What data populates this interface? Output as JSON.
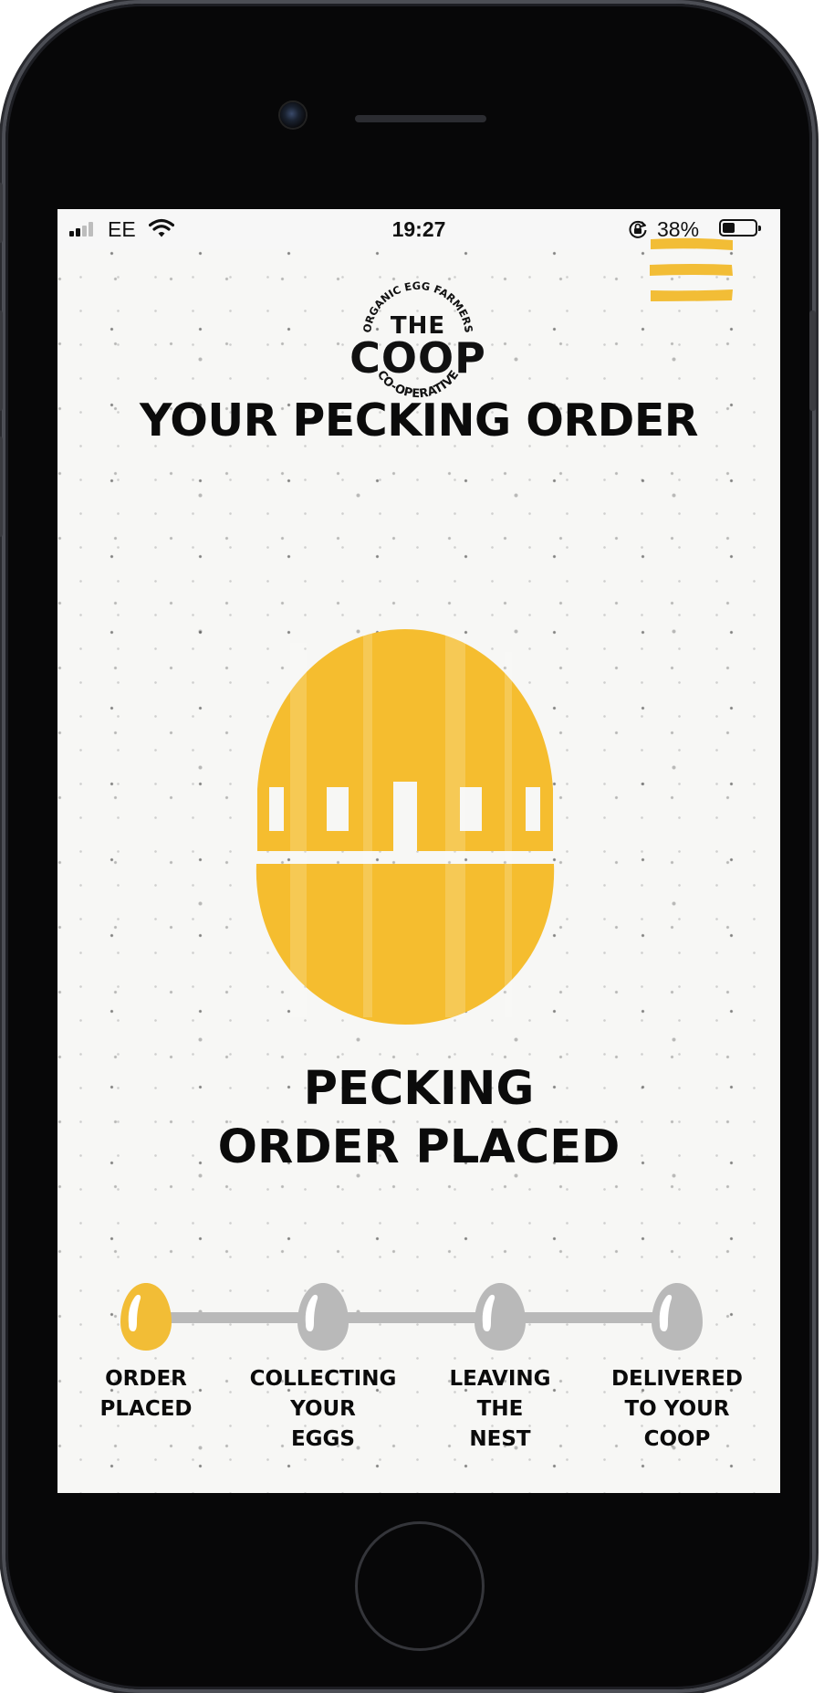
{
  "status_bar": {
    "carrier": "EE",
    "time": "19:27",
    "battery_percent": "38%",
    "battery_level": 0.38,
    "signal_bars": 2
  },
  "header": {
    "logo": {
      "arc_top": "ORGANIC EGG FARMERS",
      "the": "THE",
      "coop": "COOP",
      "arc_bottom": "CO-OPERATIVE"
    },
    "menu_icon": "hamburger-icon"
  },
  "page_title": "YOUR PECKING ORDER",
  "current_status": {
    "line1": "PECKING",
    "line2": "ORDER PLACED"
  },
  "progress": {
    "steps": [
      {
        "line1": "ORDER",
        "line2": "PLACED",
        "line3": "",
        "active": true
      },
      {
        "line1": "COLLECTING",
        "line2": "YOUR",
        "line3": "EGGS",
        "active": false
      },
      {
        "line1": "LEAVING",
        "line2": "THE",
        "line3": "NEST",
        "active": false
      },
      {
        "line1": "DELIVERED",
        "line2": "TO YOUR",
        "line3": "COOP",
        "active": false
      }
    ]
  },
  "colors": {
    "accent": "#f2bd36",
    "egg": "#f5bd2f",
    "inactive": "#b9b9b9",
    "text": "#0b0b0b"
  }
}
